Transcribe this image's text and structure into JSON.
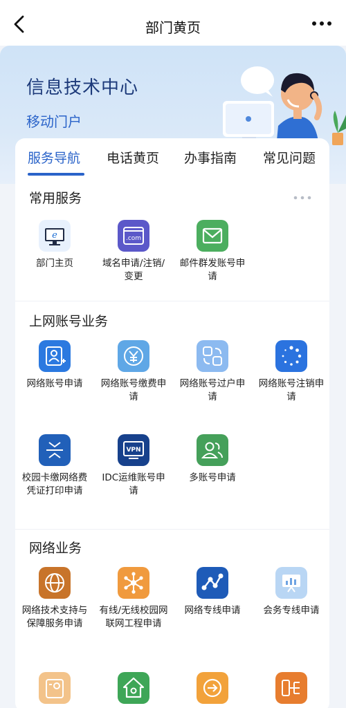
{
  "header": {
    "title": "部门黄页"
  },
  "hero": {
    "title": "信息技术中心",
    "subtitle": "移动门户"
  },
  "tabs": [
    {
      "label": "服务导航",
      "active": true
    },
    {
      "label": "电话黄页"
    },
    {
      "label": "办事指南"
    },
    {
      "label": "常见问题"
    }
  ],
  "sections": {
    "common": {
      "title": "常用服务",
      "items": [
        {
          "label": "部门主页",
          "icon": "ie-monitor-icon",
          "color": "#e8f1fd"
        },
        {
          "label": "域名申请/注销/变更",
          "icon": "com-domain-icon",
          "color": "#5b58c9"
        },
        {
          "label": "邮件群发账号申请",
          "icon": "mail-icon",
          "color": "#4cae5f"
        }
      ]
    },
    "account": {
      "title": "上网账号业务",
      "items": [
        {
          "label": "网络账号申请",
          "icon": "user-add-icon",
          "color": "#2b79e0"
        },
        {
          "label": "网络账号缴费申请",
          "icon": "yen-icon",
          "color": "#5fa7e6"
        },
        {
          "label": "网络账号过户申请",
          "icon": "transfer-icon",
          "color": "#8cbaf0"
        },
        {
          "label": "网络账号注销申请",
          "icon": "loading-dots-icon",
          "color": "#2b73df"
        },
        {
          "label": "校园卡缴网络费凭证打印申请",
          "icon": "scan-icon",
          "color": "#2160b9"
        },
        {
          "label": "IDC运维账号申请",
          "icon": "vpn-icon",
          "color": "#17418c"
        },
        {
          "label": "多账号申请",
          "icon": "users-icon",
          "color": "#45a05a"
        }
      ]
    },
    "network": {
      "title": "网络业务",
      "items": [
        {
          "label": "网络技术支持与保障服务申请",
          "icon": "globe-icon",
          "color": "#c8742a"
        },
        {
          "label": "有线/无线校园网联网工程申请",
          "icon": "hub-icon",
          "color": "#f09a3e"
        },
        {
          "label": "网络专线申请",
          "icon": "share-icon",
          "color": "#1e5bb8"
        },
        {
          "label": "会务专线申请",
          "icon": "presentation-icon",
          "color": "#b9d6f4"
        },
        {
          "label": "",
          "icon": "id-card-icon",
          "color": "#f3c38a"
        },
        {
          "label": "",
          "icon": "home-icon",
          "color": "#3ea657"
        },
        {
          "label": "",
          "icon": "arrow-circle-icon",
          "color": "#f2a23b"
        },
        {
          "label": "",
          "icon": "flow-icon",
          "color": "#e77d2f"
        }
      ]
    }
  }
}
